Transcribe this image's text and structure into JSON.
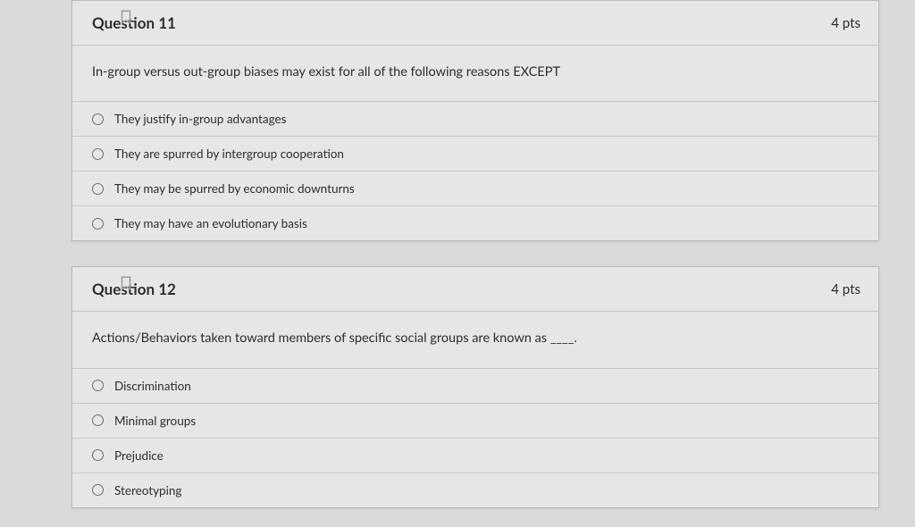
{
  "questions": [
    {
      "title": "Question 11",
      "points": "4 pts",
      "prompt": "In-group versus out-group biases may exist for all of the following reasons EXCEPT",
      "answers": [
        {
          "label": "They justify in-group advantages"
        },
        {
          "label": "They are spurred by intergroup cooperation"
        },
        {
          "label": "They may be spurred by economic downturns"
        },
        {
          "label": "They may have an evolutionary basis"
        }
      ]
    },
    {
      "title": "Question 12",
      "points": "4 pts",
      "prompt": "Actions/Behaviors taken toward members of specific social groups are known as ____.",
      "answers": [
        {
          "label": "Discrimination"
        },
        {
          "label": "Minimal groups"
        },
        {
          "label": "Prejudice"
        },
        {
          "label": "Stereotyping"
        }
      ]
    }
  ]
}
